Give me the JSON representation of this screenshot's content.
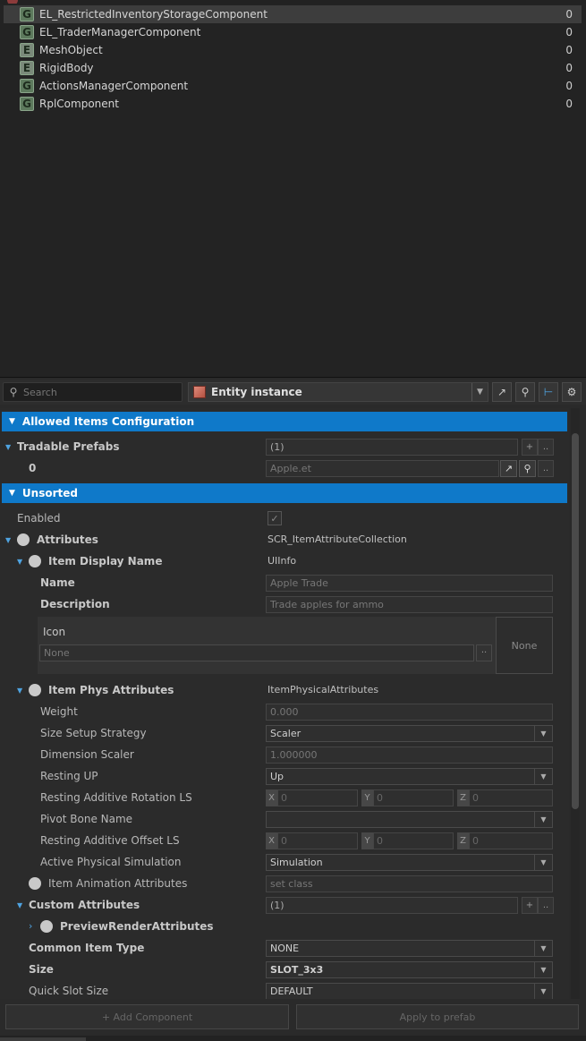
{
  "components": [
    {
      "badge": "G",
      "name": "EL_RestrictedInventoryStorageComponent",
      "value": "0",
      "selected": true
    },
    {
      "badge": "G",
      "name": "EL_TraderManagerComponent",
      "value": "0"
    },
    {
      "badge": "E",
      "name": "MeshObject",
      "value": "0"
    },
    {
      "badge": "E",
      "name": "RigidBody",
      "value": "0"
    },
    {
      "badge": "G",
      "name": "ActionsManagerComponent",
      "value": "0"
    },
    {
      "badge": "G",
      "name": "RplComponent",
      "value": "0"
    }
  ],
  "toolbar": {
    "search_placeholder": "Search",
    "entity_selector": "Entity instance",
    "icons": [
      "external-link-icon",
      "search-icon",
      "hierarchy-icon",
      "gear-icon"
    ]
  },
  "sections": {
    "allowed": "Allowed Items Configuration",
    "unsorted": "Unsorted"
  },
  "allowed": {
    "tradable_label": "Tradable Prefabs",
    "tradable_count": "(1)",
    "btn_add": "+",
    "btn_more": "..",
    "index0": "0",
    "index0_value": "Apple.et"
  },
  "props": {
    "enabled": "Enabled",
    "attributes": "Attributes",
    "attributes_class": "SCR_ItemAttributeCollection",
    "item_display_name": "Item Display Name",
    "item_display_class": "UIInfo",
    "name_label": "Name",
    "name_value": "Apple Trade",
    "desc_label": "Description",
    "desc_value": "Trade apples for ammo",
    "icon_label": "Icon",
    "icon_value": "None",
    "icon_preview": "None",
    "phys_label": "Item Phys Attributes",
    "phys_class": "ItemPhysicalAttributes",
    "weight_label": "Weight",
    "weight_value": "0.000",
    "size_strategy_label": "Size Setup Strategy",
    "size_strategy_value": "Scaler",
    "dim_scaler_label": "Dimension Scaler",
    "dim_scaler_value": "1.000000",
    "resting_up_label": "Resting UP",
    "resting_up_value": "Up",
    "resting_rot_label": "Resting Additive Rotation LS",
    "pivot_label": "Pivot Bone Name",
    "resting_off_label": "Resting Additive Offset LS",
    "active_phys_label": "Active Physical Simulation",
    "active_phys_value": "Simulation",
    "anim_label": "Item Animation Attributes",
    "anim_value": "set class",
    "custom_label": "Custom Attributes",
    "custom_count": "(1)",
    "preview_label": "PreviewRenderAttributes",
    "common_type_label": "Common Item Type",
    "common_type_value": "NONE",
    "size_label": "Size",
    "size_value": "SLOT_3x3",
    "quick_slot_label": "Quick Slot Size",
    "quick_slot_value": "DEFAULT",
    "axis_x": "X",
    "axis_y": "Y",
    "axis_z": "Z",
    "axis_zero": "0"
  },
  "bottom": {
    "add_component": "+ Add Component",
    "apply_prefab": "Apply to prefab"
  }
}
